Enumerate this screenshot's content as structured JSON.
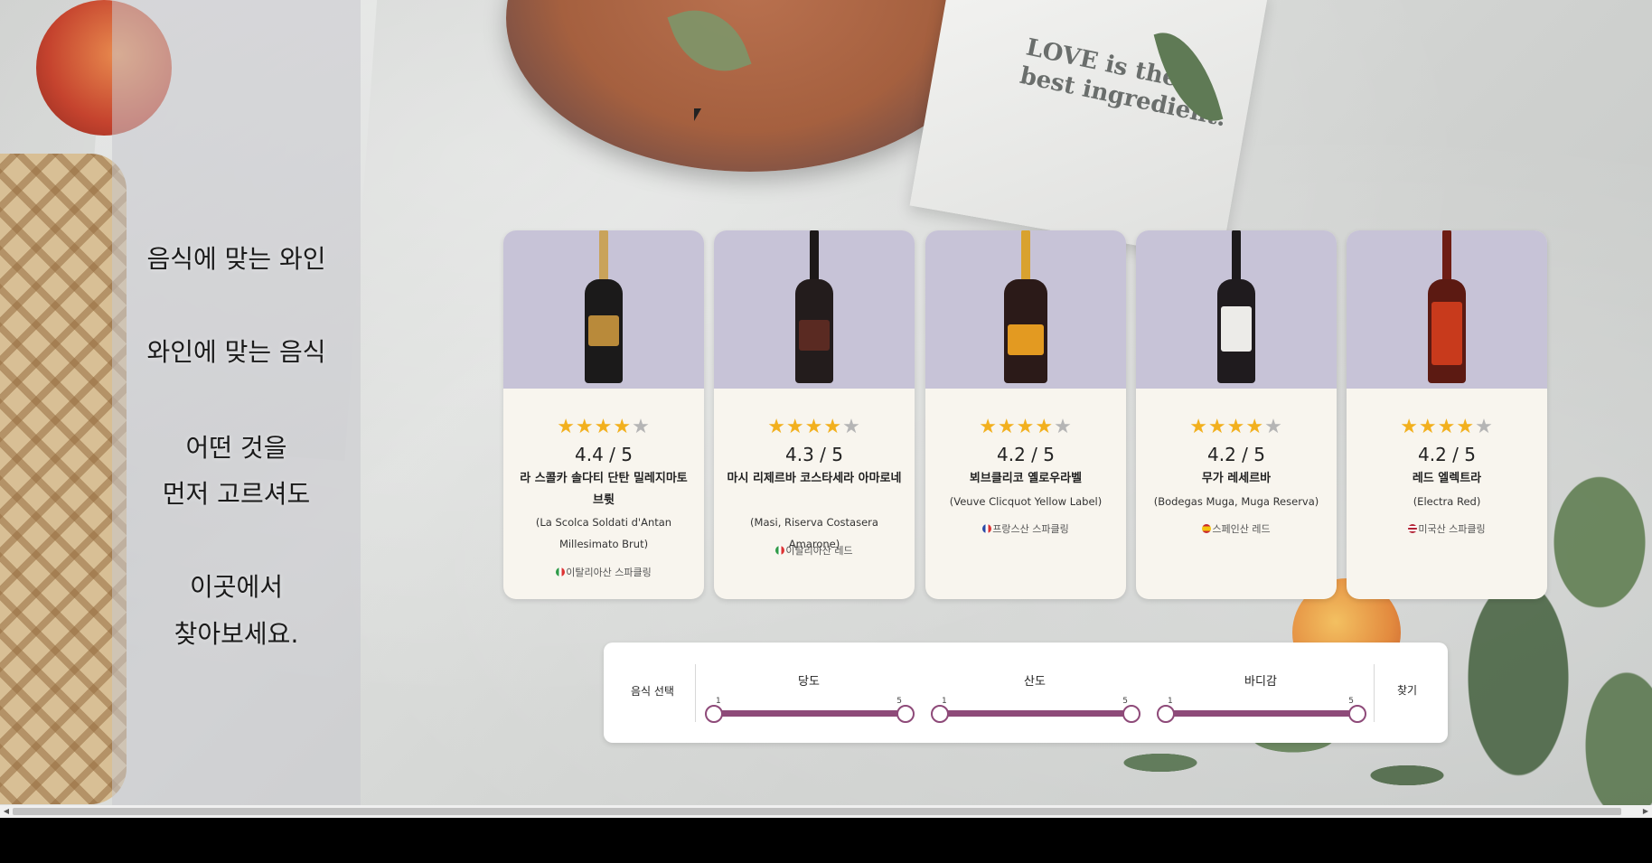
{
  "side": {
    "line1": "음식에 맞는 와인",
    "line2": "와인에 맞는 음식",
    "line3": "어떤 것을",
    "line4": "먼저 고르셔도",
    "line5": "이곳에서",
    "line6": "찾아보세요."
  },
  "napkin_text": "LOVE is the\nbest ingredient.",
  "colors": {
    "card_image_bg": "#c7c3d7",
    "card_bg": "#f8f5ee",
    "star_on": "#f2b01e",
    "star_off": "#b5b5b5",
    "slider_accent": "#8e4a79"
  },
  "cards": [
    {
      "stars": "★★★★",
      "star_half": "★",
      "stars_off": "",
      "rating_value": 4.4,
      "rating": "4.4 / 5",
      "name_ko": "라 스콜카 솔다티 단탄 밀레지마토 브륏",
      "name_en": "(La Scolca Soldati d'Antan Millesimato Brut)",
      "origin": "이탈리아산 스파클링",
      "flag": "italy-flag-icon"
    },
    {
      "stars": "★★★★",
      "star_half": "",
      "stars_off": "★",
      "rating_value": 4.3,
      "rating": "4.3 / 5",
      "name_ko": "마시 리제르바 코스타세라 아마로네",
      "name_en": "(Masi, Riserva Costasera Amarone)",
      "origin": "이탈리아산 레드",
      "flag": "italy-flag-icon"
    },
    {
      "stars": "★★★★",
      "star_half": "",
      "stars_off": "★",
      "rating_value": 4.2,
      "rating": "4.2 / 5",
      "name_ko": "뵈브클리코 옐로우라벨",
      "name_en": "(Veuve Clicquot Yellow Label)",
      "origin": "프랑스산 스파클링",
      "flag": "france-flag-icon"
    },
    {
      "stars": "★★★★",
      "star_half": "",
      "stars_off": "★",
      "rating_value": 4.2,
      "rating": "4.2 / 5",
      "name_ko": "무가 레세르바",
      "name_en": "(Bodegas Muga, Muga Reserva)",
      "origin": "스페인산 레드",
      "flag": "spain-flag-icon"
    },
    {
      "stars": "★★★★",
      "star_half": "",
      "stars_off": "★",
      "rating_value": 4.2,
      "rating": "4.2 / 5",
      "name_ko": "레드 엘렉트라",
      "name_en": "(Electra Red)",
      "origin": "미국산 스파클링",
      "flag": "usa-flag-icon"
    }
  ],
  "filter": {
    "food_select": "음식 선택",
    "sweetness": {
      "label": "당도",
      "min": "1",
      "max": "5",
      "low": 1,
      "high": 5
    },
    "acidity": {
      "label": "산도",
      "min": "1",
      "max": "5",
      "low": 1,
      "high": 5
    },
    "body": {
      "label": "바디감",
      "min": "1",
      "max": "5",
      "low": 1,
      "high": 5
    },
    "search": "찾기"
  }
}
